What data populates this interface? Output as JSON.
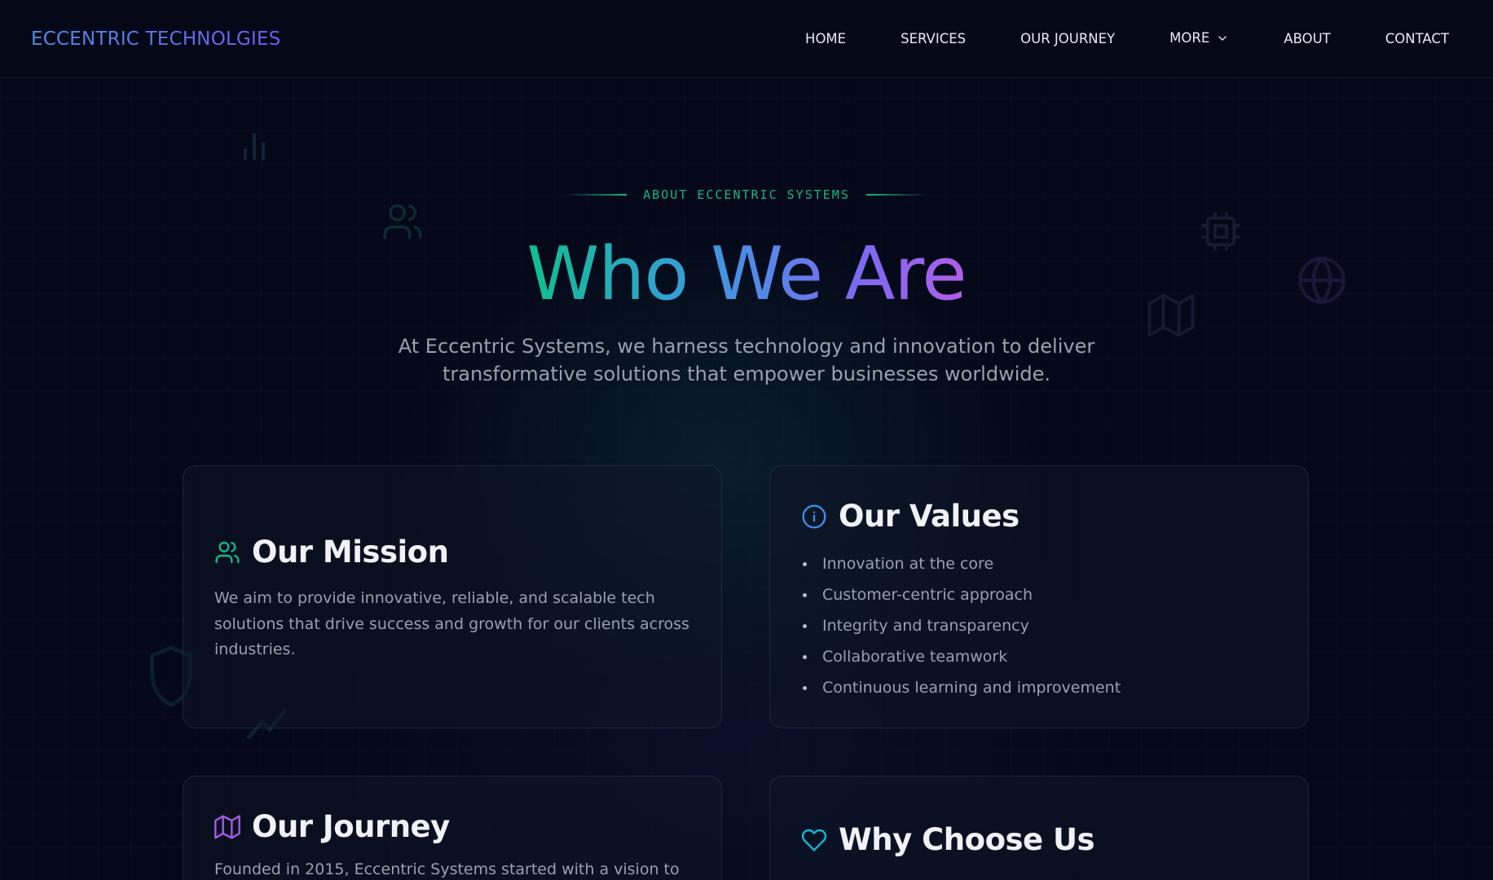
{
  "nav": {
    "brand": "ECCENTRIC TECHNOLGIES",
    "links": [
      {
        "label": "HOME"
      },
      {
        "label": "SERVICES"
      },
      {
        "label": "OUR JOURNEY"
      },
      {
        "label": "MORE"
      },
      {
        "label": "ABOUT"
      },
      {
        "label": "CONTACT"
      }
    ]
  },
  "hero": {
    "eyebrow": "ABOUT ECCENTRIC SYSTEMS",
    "title": "Who We Are",
    "subtitle": "At Eccentric Systems, we harness technology and innovation to deliver transformative solutions that empower businesses worldwide."
  },
  "cards": {
    "mission": {
      "title": "Our Mission",
      "text": "We aim to provide innovative, reliable, and scalable tech solutions that drive success and growth for our clients across industries.",
      "icon": "users-icon"
    },
    "values": {
      "title": "Our Values",
      "icon": "info-icon",
      "items": [
        "Innovation at the core",
        "Customer-centric approach",
        "Integrity and transparency",
        "Collaborative teamwork",
        "Continuous learning and improvement"
      ]
    },
    "journey": {
      "title": "Our Journey",
      "text": "Founded in 2015, Eccentric Systems started with a vision to",
      "icon": "map-icon"
    },
    "why": {
      "title": "Why Choose Us",
      "icon": "heart-icon"
    }
  },
  "colors": {
    "background": "#050818",
    "accent_green": "#12b886",
    "accent_blue": "#3b9ae0",
    "accent_purple": "#a05be8",
    "text_muted": "#9aa0b3"
  }
}
